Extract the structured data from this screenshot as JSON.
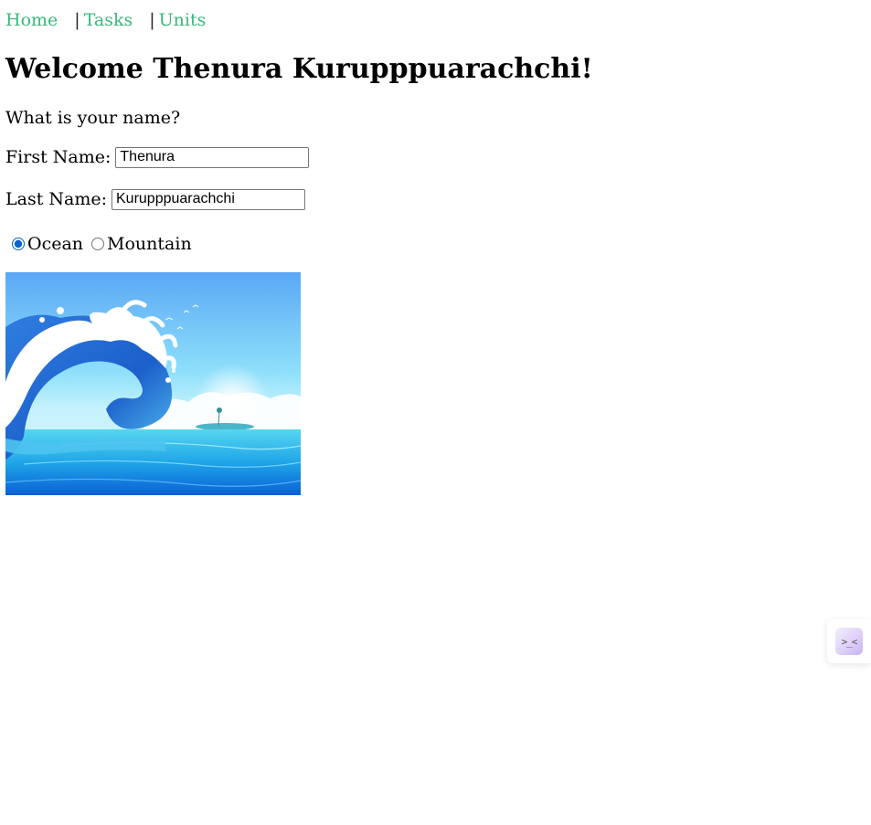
{
  "nav": {
    "items": [
      {
        "label": "Home"
      },
      {
        "label": "Tasks"
      },
      {
        "label": "Units"
      }
    ],
    "separator": "|"
  },
  "heading": "Welcome Thenura Kurupppuarachchi!",
  "question": "What is your name?",
  "form": {
    "first_name_label": "First Name:",
    "first_name_value": "Thenura",
    "last_name_label": "Last Name:",
    "last_name_value": "Kurupppuarachchi",
    "scenery_options": [
      {
        "label": "Ocean",
        "checked": true
      },
      {
        "label": "Mountain",
        "checked": false
      }
    ]
  },
  "hero_image": {
    "subject": "ocean-wave-illustration"
  },
  "widget": {
    "icon": "assistant-face-icon",
    "glyph": ">_<"
  },
  "colors": {
    "link": "#3bb77b",
    "radio_accent": "#0b63ce"
  }
}
